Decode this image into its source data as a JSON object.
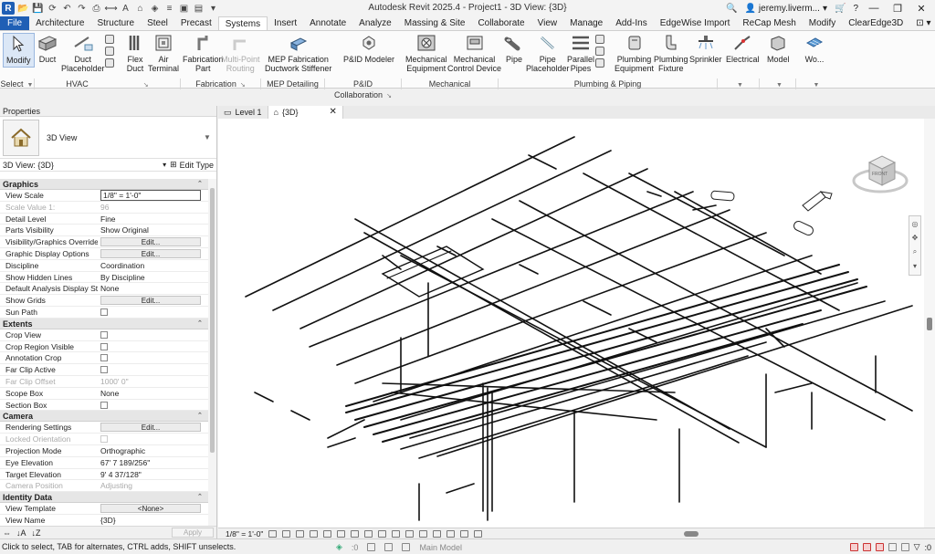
{
  "window": {
    "title": "Autodesk Revit 2025.4 - Project1 - 3D View: {3D}",
    "user": "jeremy.liverm...",
    "app_logo": "R"
  },
  "ribbon_tabs": [
    "File",
    "Architecture",
    "Structure",
    "Steel",
    "Precast",
    "Systems",
    "Insert",
    "Annotate",
    "Analyze",
    "Massing & Site",
    "Collaborate",
    "View",
    "Manage",
    "Add-Ins",
    "EdgeWise Import",
    "ReCap Mesh",
    "Modify",
    "ClearEdge3D"
  ],
  "ribbon_active_tab": "Systems",
  "ribbon": {
    "modify": "Modify",
    "duct": "Duct",
    "duct_placeholder_1": "Duct",
    "duct_placeholder_2": "Placeholder",
    "flex_duct_1": "Flex",
    "flex_duct_2": "Duct",
    "air_terminal_1": "Air",
    "air_terminal_2": "Terminal",
    "fabrication_part_1": "Fabrication",
    "fabrication_part_2": "Part",
    "multipoint_routing_1": "Multi-Point",
    "multipoint_routing_2": "Routing",
    "mep_fab_1": "MEP Fabrication",
    "mep_fab_2": "Ductwork Stiffener",
    "pid_modeler": "P&ID Modeler",
    "mech_equipment_1": "Mechanical",
    "mech_equipment_2": "Equipment",
    "mech_control_1": "Mechanical",
    "mech_control_2": "Control Device",
    "pipe": "Pipe",
    "pipe_placeholder_1": "Pipe",
    "pipe_placeholder_2": "Placeholder",
    "parallel_pipes_1": "Parallel",
    "parallel_pipes_2": "Pipes",
    "plumbing_equipment_1": "Plumbing",
    "plumbing_equipment_2": "Equipment",
    "plumbing_fixture_1": "Plumbing",
    "plumbing_fixture_2": "Fixture",
    "sprinkler": "Sprinkler",
    "electrical": "Electrical",
    "model": "Model",
    "work": "Wo..."
  },
  "ribbon_panels": {
    "select": "Select",
    "hvac": "HVAC",
    "fabrication": "Fabrication",
    "mep_detailing": "MEP Detailing",
    "pid_collaboration": "P&ID Collaboration",
    "mechanical": "Mechanical",
    "plumbing_piping": "Plumbing & Piping"
  },
  "properties": {
    "header": "Properties",
    "type_name": "3D View",
    "instance": "3D View: {3D}",
    "edit_type": "Edit Type",
    "apply": "Apply",
    "sections": {
      "graphics": "Graphics",
      "extents": "Extents",
      "camera": "Camera",
      "identity": "Identity Data"
    },
    "rows": {
      "view_scale": [
        "View Scale",
        "1/8\" = 1'-0\""
      ],
      "scale_value": [
        "Scale Value    1:",
        "96"
      ],
      "detail_level": [
        "Detail Level",
        "Fine"
      ],
      "parts_visibility": [
        "Parts Visibility",
        "Show Original"
      ],
      "vg_overrides": [
        "Visibility/Graphics Overrides",
        "Edit..."
      ],
      "graphic_display": [
        "Graphic Display Options",
        "Edit..."
      ],
      "discipline": [
        "Discipline",
        "Coordination"
      ],
      "hidden_lines": [
        "Show Hidden Lines",
        "By Discipline"
      ],
      "analysis_style": [
        "Default Analysis Display Sty...",
        "None"
      ],
      "show_grids": [
        "Show Grids",
        "Edit..."
      ],
      "sun_path": [
        "Sun Path",
        ""
      ],
      "crop_view": [
        "Crop View",
        ""
      ],
      "crop_region": [
        "Crop Region Visible",
        ""
      ],
      "annotation_crop": [
        "Annotation Crop",
        ""
      ],
      "far_clip_active": [
        "Far Clip Active",
        ""
      ],
      "far_clip_offset": [
        "Far Clip Offset",
        "1000'  0\""
      ],
      "scope_box": [
        "Scope Box",
        "None"
      ],
      "section_box": [
        "Section Box",
        ""
      ],
      "rendering": [
        "Rendering Settings",
        "Edit..."
      ],
      "locked_orientation": [
        "Locked Orientation",
        ""
      ],
      "projection": [
        "Projection Mode",
        "Orthographic"
      ],
      "eye_elevation": [
        "Eye Elevation",
        "67'  7 189/256\""
      ],
      "target_elevation": [
        "Target Elevation",
        "9'  4 37/128\""
      ],
      "camera_position": [
        "Camera Position",
        "Adjusting"
      ],
      "view_template": [
        "View Template",
        "<None>"
      ],
      "view_name": [
        "View Name",
        "{3D}"
      ]
    }
  },
  "doc_tabs": [
    {
      "label": "Level 1"
    },
    {
      "label": "{3D}"
    }
  ],
  "view_scale_bar": "1/8\" = 1'-0\"",
  "viewcube": {
    "face_label": "FRONT"
  },
  "status": {
    "hint": "Click to select, TAB for alternates, CTRL adds, SHIFT unselects.",
    "worksets_count": ":0",
    "design_options": ":0",
    "model": "Main Model",
    "filter_count": ":0"
  }
}
